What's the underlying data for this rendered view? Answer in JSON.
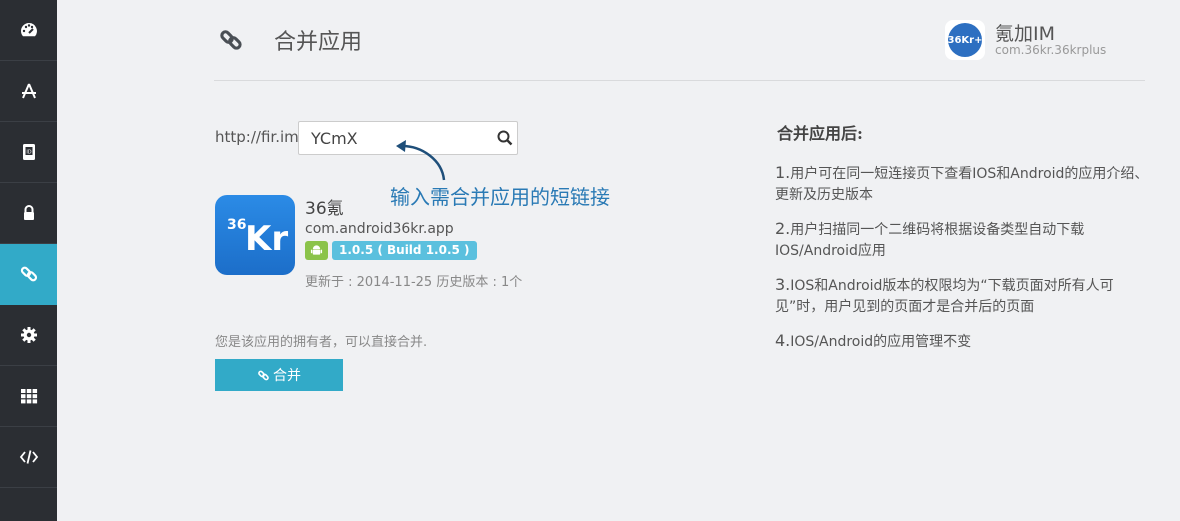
{
  "sidebar": {
    "items": [
      {
        "icon": "dashboard-icon"
      },
      {
        "icon": "app-store-icon"
      },
      {
        "icon": "id-card-icon"
      },
      {
        "icon": "lock-icon"
      },
      {
        "icon": "link-icon",
        "active": true
      },
      {
        "icon": "gear-icon"
      },
      {
        "icon": "grid-icon"
      },
      {
        "icon": "code-icon"
      }
    ]
  },
  "header": {
    "title": "合并应用",
    "icon": "link-icon",
    "app_name": "氪加IM",
    "app_package": "com.36kr.36krplus",
    "avatar_text": "36Kr+"
  },
  "search": {
    "prefix": "http://fir.im/",
    "value": "YCmX"
  },
  "annotation": {
    "text": "输入需合并应用的短链接"
  },
  "card": {
    "icon_num": "36",
    "icon_kr": "Kr",
    "name": "36氪",
    "package": "com.android36kr.app",
    "version": "1.0.5 ( Build 1.0.5 )",
    "meta": "更新于 : 2014-11-25  历史版本 : 1个"
  },
  "owner_note": "您是该应用的拥有者，可以直接合并.",
  "merge_button": "合并",
  "info": {
    "title": "合并应用后:",
    "items": [
      {
        "num": "1.",
        "text": "用户可在同一短连接页下查看IOS和Android的应用介绍、更新及历史版本"
      },
      {
        "num": "2.",
        "text": "用户扫描同一个二维码将根据设备类型自动下载IOS/Android应用"
      },
      {
        "num": "3.",
        "text": "IOS和Android版本的权限均为“下载页面对所有人可见”时，用户见到的页面才是合并后的页面"
      },
      {
        "num": "4.",
        "text": "IOS/Android的应用管理不变"
      }
    ]
  },
  "colors": {
    "sidebar_bg": "#2b2e33",
    "accent": "#32aac8",
    "annotation": "#2a7ab5",
    "android_green": "#8bc34a",
    "version_blue": "#5bc0de"
  }
}
